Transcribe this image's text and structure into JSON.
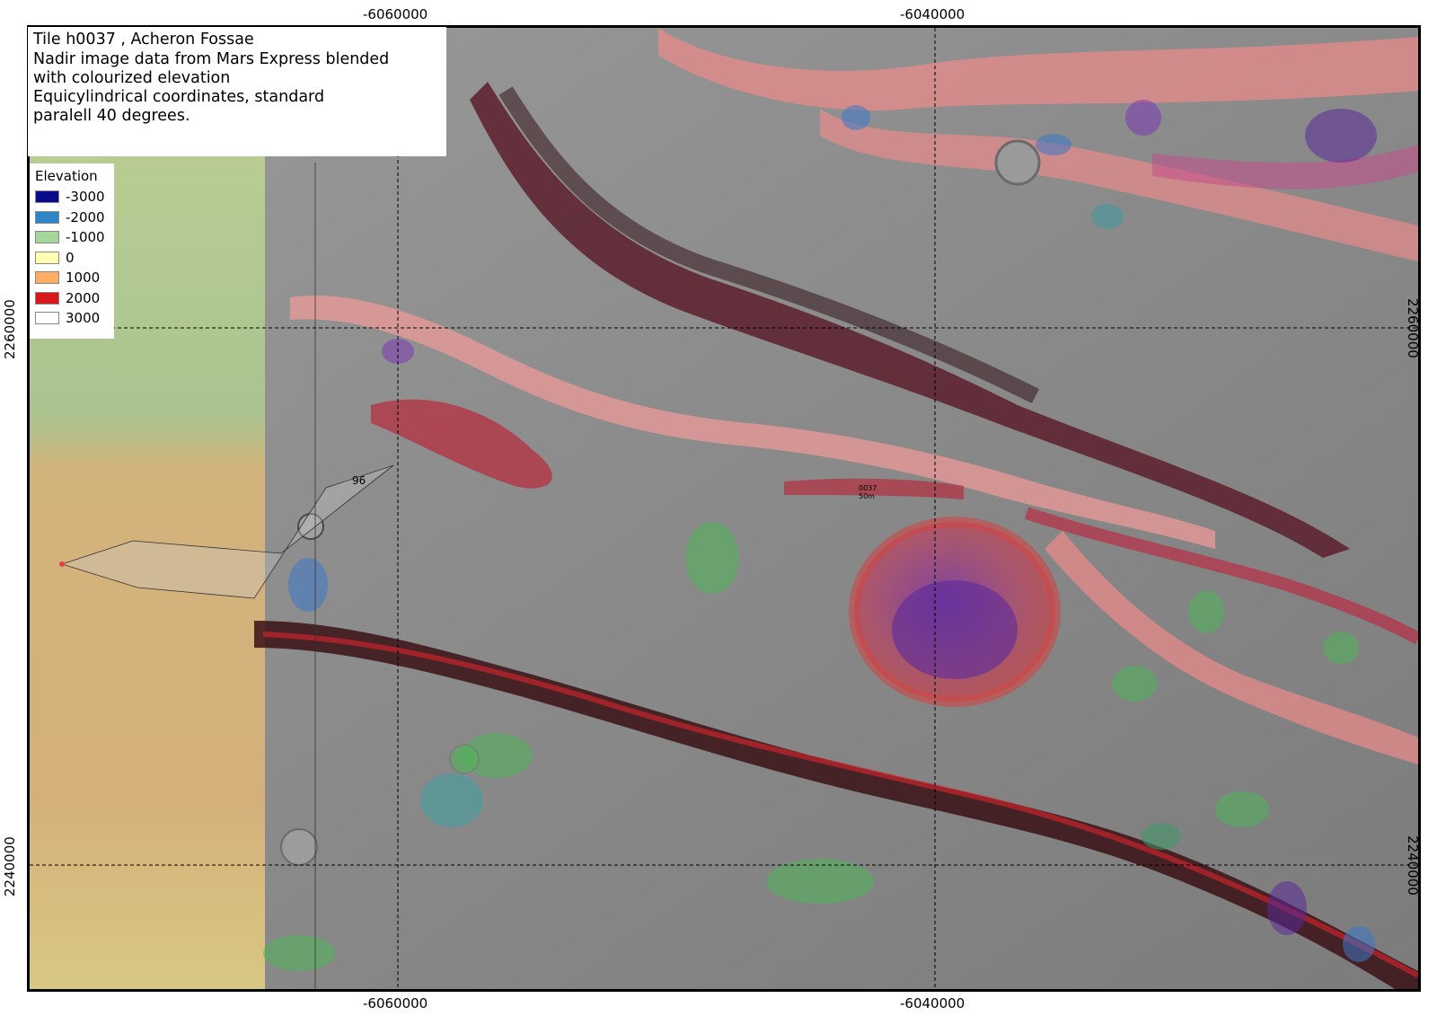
{
  "title_lines": [
    "Tile h0037 , Acheron Fossae",
    "Nadir image data from Mars Express blended",
    "with colourized elevation",
    "Equicylindrical coordinates, standard",
    "paralell 40 degrees."
  ],
  "legend": {
    "title": "Elevation",
    "items": [
      {
        "label": "-3000",
        "color": "#0a0a8c"
      },
      {
        "label": "-2000",
        "color": "#2f86c6"
      },
      {
        "label": "-1000",
        "color": "#a6d79a"
      },
      {
        "label": "0",
        "color": "#ffffb2"
      },
      {
        "label": "1000",
        "color": "#fdae61"
      },
      {
        "label": "2000",
        "color": "#d7191c"
      },
      {
        "label": "3000",
        "color": "#ffffff"
      }
    ]
  },
  "axes": {
    "x_ticks": [
      "-6060000",
      "-6040000"
    ],
    "y_ticks": [
      "2260000",
      "2240000"
    ]
  },
  "annotations": {
    "orbit_number": "96",
    "tile_id": "0037",
    "resolution": "50m"
  },
  "colors": {
    "terrain_gray": "#8d8d8d",
    "plateau_green": "#a8c48e",
    "plateau_tan": "#d7b07a",
    "trough_red": "#d13a3a",
    "highland_pink": "#f08a8a",
    "low_purple": "#7a3ab0",
    "low_green": "#4fb45a",
    "low_blue": "#3c78c8"
  }
}
